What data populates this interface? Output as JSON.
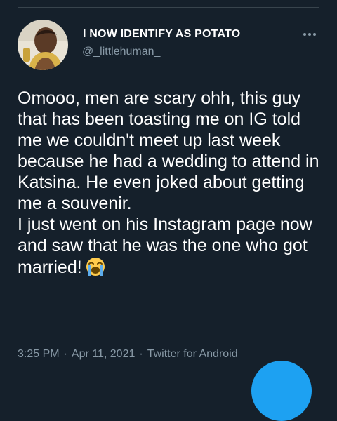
{
  "user": {
    "display_name": "I NOW IDENTIFY AS POTATO",
    "handle": "@_littlehuman_",
    "avatar_icon": "profile-photo"
  },
  "more_icon": "more-horizontal-icon",
  "tweet": {
    "paragraph_1": "Omooo, men are scary ohh, this guy that has been toasting me on IG told me we couldn't meet up last week because he had a wedding to attend in Katsina. He even joked about getting me a souvenir.",
    "paragraph_2": "I just went on his Instagram page now and saw that he was the one who got married!",
    "emoji": "loudly-crying-face"
  },
  "meta": {
    "time": "3:25 PM",
    "date": "Apr 11, 2021",
    "source": "Twitter for Android",
    "separator": "·"
  },
  "colors": {
    "background": "#15202b",
    "text": "#ffffff",
    "secondary": "#8899a6",
    "accent": "#1da1f2",
    "divider": "#38444d"
  }
}
